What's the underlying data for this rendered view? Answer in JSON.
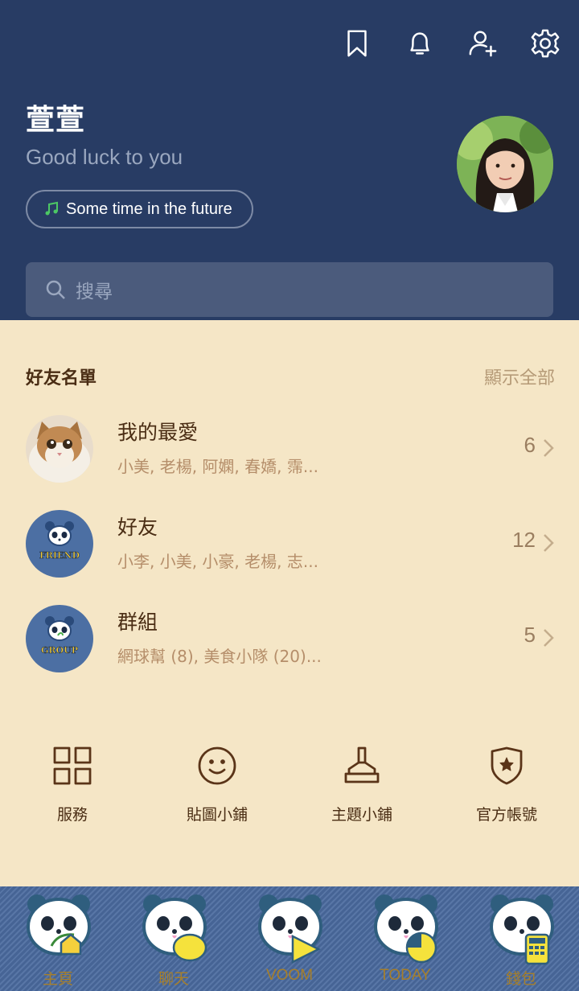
{
  "header": {
    "icons": [
      "bookmark-icon",
      "bell-icon",
      "add-friend-icon",
      "gear-icon"
    ],
    "profile_name": "萱萱",
    "status_message": "Good luck to you",
    "music": "Some time in the future",
    "search_placeholder": "搜尋"
  },
  "friends": {
    "section_title": "好友名單",
    "show_all": "顯示全部",
    "rows": [
      {
        "title": "我的最愛",
        "subtitle": "小美, 老楊, 阿嫻, 春嬌, 霈...",
        "count": "6"
      },
      {
        "title": "好友",
        "subtitle": "小李, 小美, 小豪, 老楊, 志...",
        "count": "12",
        "badge": "FRIEND"
      },
      {
        "title": "群組",
        "subtitle": "網球幫 (8), 美食小隊 (20)...",
        "count": "5",
        "badge": "GROUP"
      }
    ]
  },
  "shortcuts": [
    {
      "label": "服務",
      "icon": "grid-icon"
    },
    {
      "label": "貼圖小鋪",
      "icon": "smiley-icon"
    },
    {
      "label": "主題小鋪",
      "icon": "brush-icon"
    },
    {
      "label": "官方帳號",
      "icon": "shield-star-icon"
    }
  ],
  "nav": [
    {
      "label": "主頁",
      "icon": "home-icon"
    },
    {
      "label": "聊天",
      "icon": "chat-icon"
    },
    {
      "label": "VOOM",
      "icon": "voom-icon"
    },
    {
      "label": "TODAY",
      "icon": "today-icon"
    },
    {
      "label": "錢包",
      "icon": "wallet-icon"
    }
  ],
  "colors": {
    "header_bg": "#283c64",
    "body_bg": "#f5e6c6",
    "brown_text": "#4a2d14",
    "denim": "#4a6a9e"
  }
}
